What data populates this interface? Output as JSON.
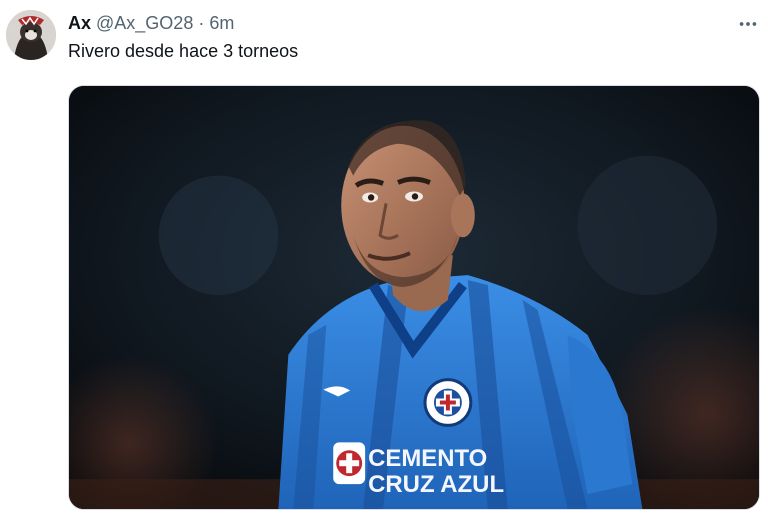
{
  "tweet": {
    "author_name": "Ax",
    "author_handle": "@Ax_GO28",
    "separator": "·",
    "time": "6m",
    "text": "Rivero desde hace 3 torneos",
    "more_icon": "more-dots-icon",
    "avatar_icon": "profile-avatar"
  },
  "media": {
    "jersey_sponsor_line1": "CEMENTO",
    "jersey_sponsor_line2": "CRUZ AZUL",
    "jersey_color": "#2f7fd8"
  }
}
